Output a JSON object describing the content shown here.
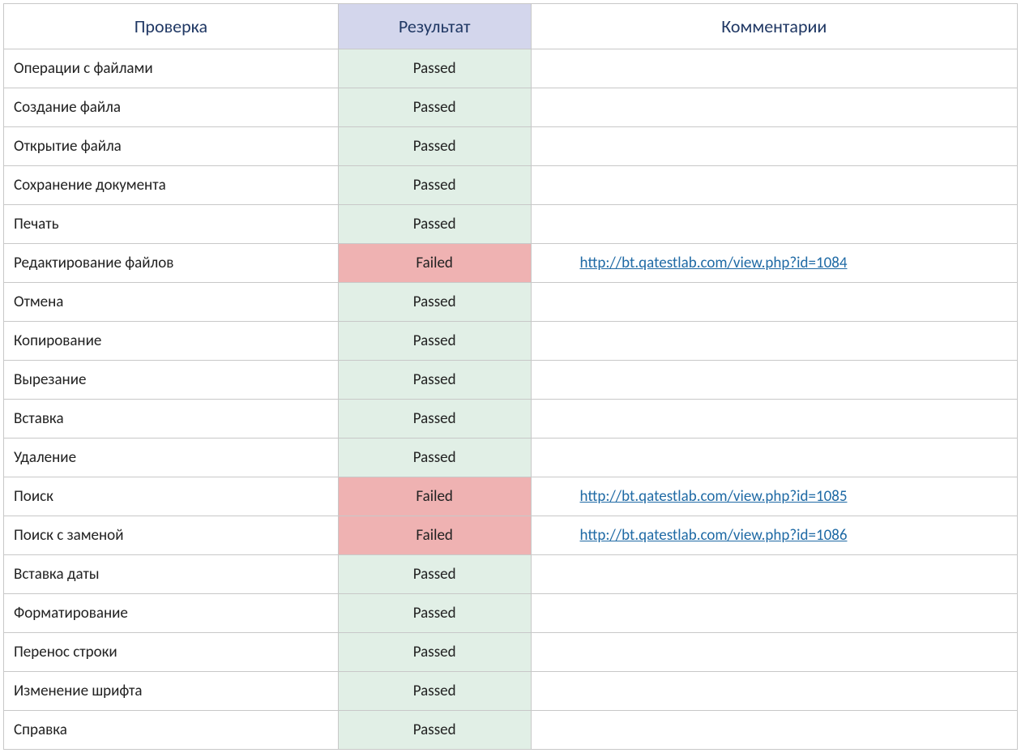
{
  "table": {
    "headers": {
      "check": "Проверка",
      "result": "Результат",
      "comment": "Комментарии"
    },
    "rows": [
      {
        "check": "Операции с файлами",
        "result": "Passed",
        "status": "passed",
        "comment": ""
      },
      {
        "check": "Создание файла",
        "result": "Passed",
        "status": "passed",
        "comment": ""
      },
      {
        "check": "Открытие файла",
        "result": "Passed",
        "status": "passed",
        "comment": ""
      },
      {
        "check": "Сохранение документа",
        "result": "Passed",
        "status": "passed",
        "comment": ""
      },
      {
        "check": "Печать",
        "result": "Passed",
        "status": "passed",
        "comment": ""
      },
      {
        "check": "Редактирование файлов",
        "result": "Failed",
        "status": "failed",
        "comment": " http://bt.qatestlab.com/view.php?id=1084"
      },
      {
        "check": "Отмена",
        "result": "Passed",
        "status": "passed",
        "comment": ""
      },
      {
        "check": "Копирование",
        "result": "Passed",
        "status": "passed",
        "comment": ""
      },
      {
        "check": "Вырезание",
        "result": "Passed",
        "status": "passed",
        "comment": ""
      },
      {
        "check": "Вставка",
        "result": "Passed",
        "status": "passed",
        "comment": ""
      },
      {
        "check": "Удаление",
        "result": "Passed",
        "status": "passed",
        "comment": ""
      },
      {
        "check": "Поиск",
        "result": "Failed",
        "status": "failed",
        "comment": "http://bt.qatestlab.com/view.php?id=1085"
      },
      {
        "check": "Поиск с заменой",
        "result": "Failed",
        "status": "failed",
        "comment": "http://bt.qatestlab.com/view.php?id=1086"
      },
      {
        "check": "Вставка даты",
        "result": "Passed",
        "status": "passed",
        "comment": ""
      },
      {
        "check": "Форматирование",
        "result": "Passed",
        "status": "passed",
        "comment": ""
      },
      {
        "check": "Перенос строки",
        "result": "Passed",
        "status": "passed",
        "comment": ""
      },
      {
        "check": "Изменение шрифта",
        "result": "Passed",
        "status": "passed",
        "comment": ""
      },
      {
        "check": "Справка",
        "result": "Passed",
        "status": "passed",
        "comment": ""
      }
    ]
  }
}
